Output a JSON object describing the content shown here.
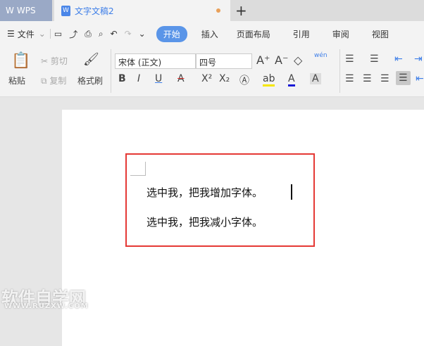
{
  "tabs": {
    "app": "WPS",
    "doc": "文字文稿2"
  },
  "menu": {
    "file": "文件",
    "items": [
      "开始",
      "插入",
      "页面布局",
      "引用",
      "审阅",
      "视图"
    ]
  },
  "ribbon": {
    "paste": "粘贴",
    "cut": "剪切",
    "copy": "复制",
    "format_painter": "格式刷",
    "font": "宋体 (正文)",
    "size": "四号",
    "pinyin": "wén"
  },
  "doc": {
    "line1": "选中我，把我增加字体。",
    "line2": "选中我，把我减小字体。"
  },
  "watermark": {
    "title": "软件自学网",
    "url": "WWW.RUZXW.COM"
  }
}
